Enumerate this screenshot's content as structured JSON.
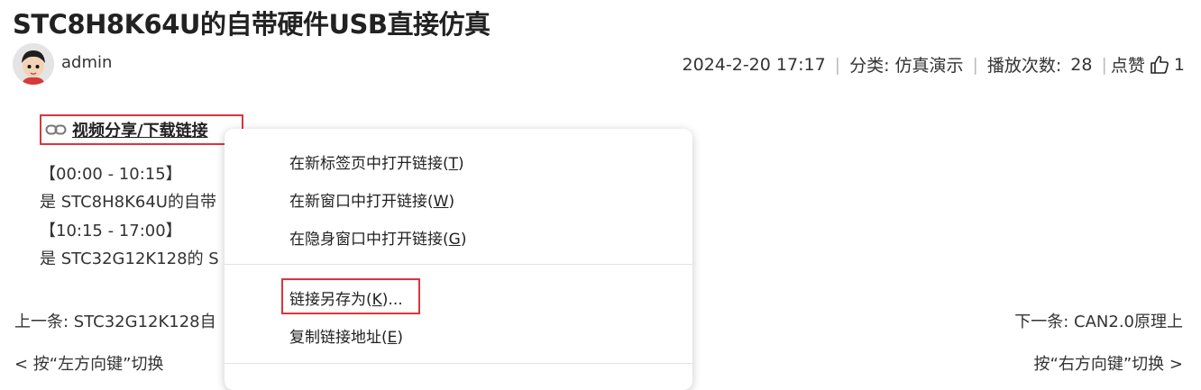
{
  "article": {
    "title": "STC8H8K64U的自带硬件USB直接仿真",
    "author": "admin",
    "date": "2024-2-20 17:17",
    "category_label": "分类:",
    "category_value": "仿真演示",
    "plays_label": "播放次数:",
    "plays_value": "28",
    "likes_label": "点赞",
    "likes_value": "1"
  },
  "link": {
    "text": "视频分享/下载链接",
    "icon": "link-chain-icon"
  },
  "description": {
    "segment1_time": "【00:00 - 10:15】",
    "segment1_text": "是 STC8H8K64U的自带",
    "segment2_time": "【10:15 - 17:00】",
    "segment2_text": "是 STC32G12K128的 S"
  },
  "navigation": {
    "prev": "上一条: STC32G12K128自",
    "next": "下一条: CAN2.0原理上",
    "prev_hint": "< 按“左方向键”切换",
    "next_hint": "按“右方向键”切换 >"
  },
  "context_menu": {
    "items": [
      {
        "label": "在新标签页中打开链接(",
        "key": "T",
        "suffix": ")"
      },
      {
        "label": "在新窗口中打开链接(",
        "key": "W",
        "suffix": ")"
      },
      {
        "label": "在隐身窗口中打开链接(",
        "key": "G",
        "suffix": ")"
      },
      {
        "label": "链接另存为(",
        "key": "K",
        "suffix": ")..."
      },
      {
        "label": "复制链接地址(",
        "key": "E",
        "suffix": ")"
      }
    ]
  },
  "colors": {
    "highlight_border": "#d9363e",
    "text": "#333333"
  }
}
